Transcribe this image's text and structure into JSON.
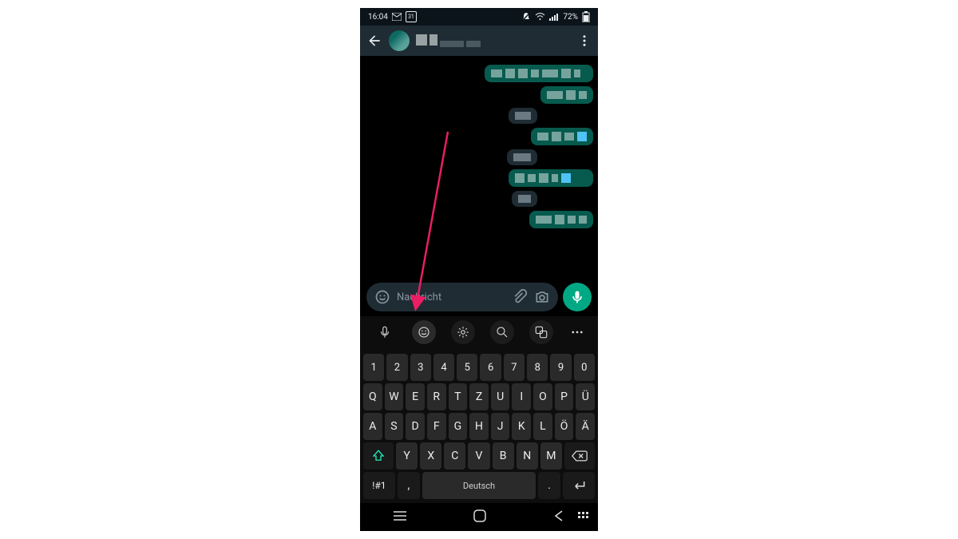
{
  "statusbar": {
    "time": "16:04",
    "date_icon": "31",
    "battery": "72%"
  },
  "chat": {
    "contact_name_pixelated": true,
    "composer_placeholder": "Nachricht"
  },
  "keyboard": {
    "row_numbers": [
      "1",
      "2",
      "3",
      "4",
      "5",
      "6",
      "7",
      "8",
      "9",
      "0"
    ],
    "row1": [
      "Q",
      "W",
      "E",
      "R",
      "T",
      "Z",
      "U",
      "I",
      "O",
      "P",
      "Ü"
    ],
    "row2": [
      "A",
      "S",
      "D",
      "F",
      "G",
      "H",
      "J",
      "K",
      "L",
      "Ö",
      "Ä"
    ],
    "row3": [
      "Y",
      "X",
      "C",
      "V",
      "B",
      "N",
      "M"
    ],
    "special": {
      "symbols": "!#1",
      "comma": ",",
      "space_label": "Deutsch",
      "period": "."
    }
  }
}
